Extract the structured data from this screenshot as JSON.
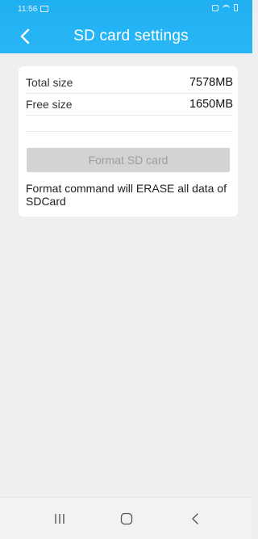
{
  "status_bar": {
    "time": "11:56"
  },
  "header": {
    "title": "SD card settings"
  },
  "storage": {
    "total_label": "Total size",
    "total_value": "7578MB",
    "free_label": "Free size",
    "free_value": "1650MB"
  },
  "actions": {
    "format_label": "Format SD card"
  },
  "warning_text": "Format command will ERASE all data of SDCard",
  "colors": {
    "header_bg": "#29b6f6",
    "page_bg": "#efefef",
    "button_disabled_bg": "#d3d3d3"
  }
}
